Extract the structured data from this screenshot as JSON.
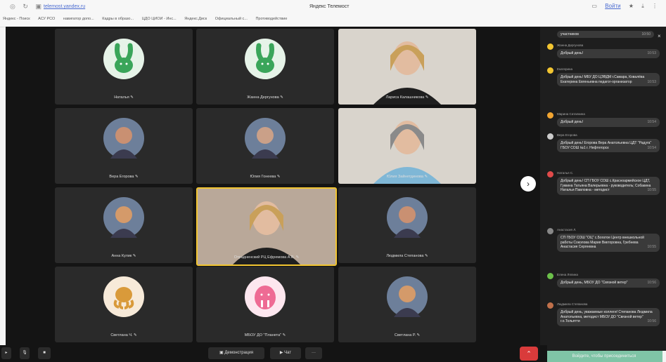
{
  "browser": {
    "address": "telemost.yandex.ru",
    "tab_title": "Яндекс Телемост",
    "bookmarks": [
      "Яндекс - Поиск",
      "АСУ РСО",
      "навигатор допо...",
      "Кадры в образо...",
      "ЦДО ЦИОИ - Инс...",
      "Яндекс.Диск",
      "Официальный с...",
      "Противодействие"
    ],
    "right_label": "Войти"
  },
  "tiles": [
    {
      "name": "Наталья",
      "kind": "bunny"
    },
    {
      "name": "Жанна Дергунова",
      "kind": "bunny"
    },
    {
      "name": "Лариса Калашникова",
      "kind": "photo"
    },
    {
      "name": "Вера Егорова",
      "kind": "face"
    },
    {
      "name": "Юлия Гонеева",
      "kind": "face"
    },
    {
      "name": "Юлия Зайнетдинова",
      "kind": "photo"
    },
    {
      "name": "Анна Кулик",
      "kind": "face"
    },
    {
      "name": "Отрадненский РЦ Ефремова А.В.",
      "kind": "photo"
    },
    {
      "name": "Людмила Степанова",
      "kind": "face"
    },
    {
      "name": "Светлана Ч.",
      "kind": "octopus"
    },
    {
      "name": "МБОУ ДО \"Планета\"",
      "kind": "walrus"
    },
    {
      "name": "Светлана Р.",
      "kind": "face"
    }
  ],
  "chat": {
    "top_fragment": "участников",
    "top_time": "10:50",
    "messages": [
      {
        "author": "Жанна Дергунова",
        "text": "Добрый день!",
        "time": "10:53",
        "color": "#f2c531"
      },
      {
        "author": "Екатерина",
        "text": "Добрый день! МБУ ДО ЦЭВДМ г.Самара, Ковалёва Екатерина Евгеньевна педагог-организатор",
        "time": "10:53",
        "color": "#f2c531"
      },
      {
        "author": "Марина Саталкина",
        "text": "Добрый день!",
        "time": "10:54",
        "color": "#f2a531"
      },
      {
        "author": "Вера Егорова",
        "text": "Добрый день! Егорова Вера Анатольевна ЦДТ \"Радуга\" ГБОУ СОШ №1 г. Нефтегорск",
        "time": "10:54",
        "color": "#cccccc"
      },
      {
        "author": "Наталья С.",
        "text": "Добрый день! СП ГБОУ СОШ с.Красноармейское ЦДТ, Гуккина Татьяна Валерьевна - руководитель; Собакина Наталья Павловна - методист",
        "time": "10:55",
        "color": "#e04a4a"
      },
      {
        "author": "Анастасия Л.",
        "text": "СП ГБОУ СОШ \"ОЦ\" с.Богатое Центр внешкольной работы Соколова Мария Викторовна, Гребнева Анастасия Сергеевна",
        "time": "10:55",
        "color": "#888888"
      },
      {
        "author": "Елена Лялина",
        "text": "Добрый день, МБОУ ДО \"Связной ветер\"",
        "time": "10:56",
        "color": "#6cc04a"
      },
      {
        "author": "Людмила Степанова",
        "text": "Добрый день, уважаемые коллеги! Степанова Людмила Анатольевна, методист МБОУ ДО \"Связной ветер\" г.о.Тольятти",
        "time": "10:56",
        "color": "#c0704a"
      }
    ],
    "input_placeholder": "Войдите, чтобы присоединиться"
  },
  "controls": {
    "screen_share_label": "Демонстрация",
    "chat_label": "Чат",
    "more_label": "···"
  }
}
